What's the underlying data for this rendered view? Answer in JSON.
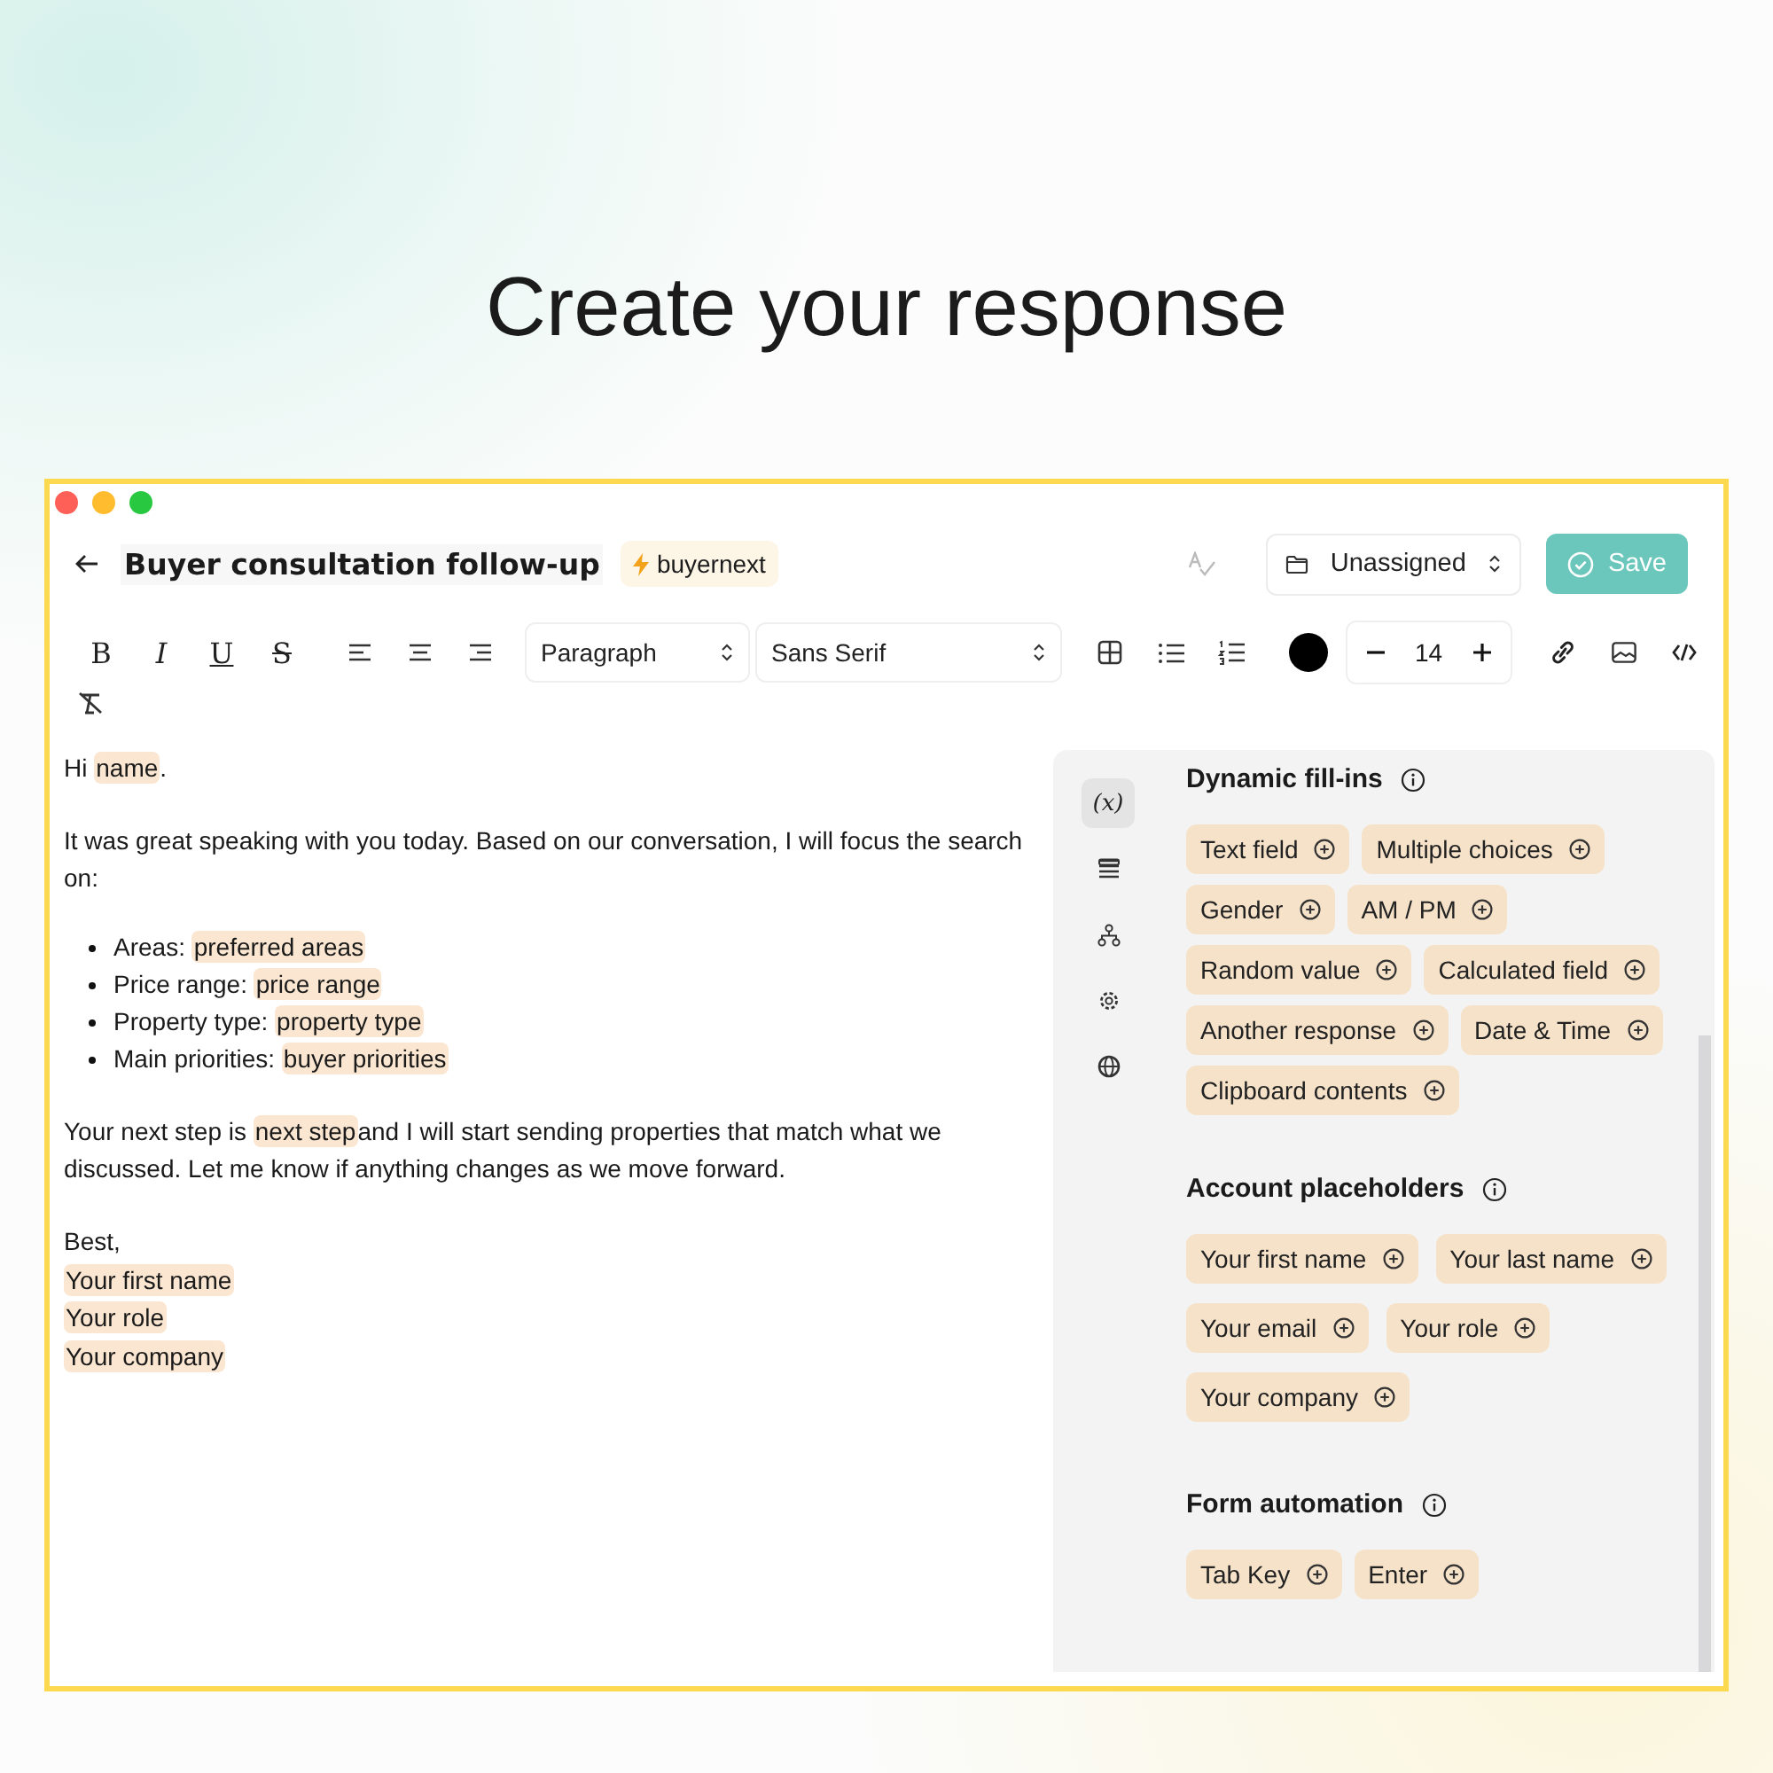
{
  "heading": "Create your response",
  "header": {
    "title": "Buyer consultation follow-up",
    "tag": "buyernext",
    "folder": "Unassigned",
    "save": "Save"
  },
  "toolbar": {
    "format": [
      {
        "kind": "bold",
        "label": "B"
      },
      {
        "kind": "italic",
        "label": "I"
      },
      {
        "kind": "underline",
        "label": "U"
      },
      {
        "kind": "strike",
        "label": "S"
      }
    ],
    "align": [
      {
        "kind": "left"
      },
      {
        "kind": "center"
      },
      {
        "kind": "right"
      }
    ],
    "block_style": "Paragraph",
    "font": "Sans Serif",
    "insert": [
      {
        "kind": "table"
      },
      {
        "kind": "bullets"
      },
      {
        "kind": "numbers"
      }
    ],
    "size": "14",
    "media": [
      {
        "kind": "link"
      },
      {
        "kind": "image"
      },
      {
        "kind": "code"
      }
    ],
    "extra": [
      {
        "kind": "clear"
      }
    ]
  },
  "body": [
    {
      "kind": "p",
      "parts": [
        {
          "text": "Hi "
        },
        {
          "fill": "name"
        },
        {
          "text": "."
        }
      ]
    },
    {
      "kind": "p",
      "parts": [
        {
          "text": "It was great speaking with you today. Based on our conversation, I will focus the search on:"
        }
      ]
    },
    {
      "kind": "list",
      "items": [
        {
          "parts": [
            {
              "text": "Areas: "
            },
            {
              "fill": "preferred areas"
            }
          ]
        },
        {
          "parts": [
            {
              "text": "Price range: "
            },
            {
              "fill": "price range"
            }
          ]
        },
        {
          "parts": [
            {
              "text": "Property type: "
            },
            {
              "fill": "property type"
            }
          ]
        },
        {
          "parts": [
            {
              "text": "Main priorities: "
            },
            {
              "fill": "buyer priorities"
            }
          ]
        }
      ]
    },
    {
      "kind": "p",
      "parts": [
        {
          "text": "Your next step is "
        },
        {
          "fill": "next step"
        },
        {
          "text": "and I will start sending properties that match what we discussed. Let me know if anything changes as we move forward."
        }
      ]
    },
    {
      "kind": "lines",
      "lines": [
        {
          "parts": [
            {
              "text": "Best,"
            }
          ]
        },
        {
          "parts": [
            {
              "fill": "Your first name"
            }
          ]
        },
        {
          "parts": [
            {
              "fill": "Your role"
            }
          ]
        },
        {
          "parts": [
            {
              "fill": "Your company"
            }
          ]
        }
      ]
    }
  ],
  "panel": {
    "rail": [
      {
        "kind": "variables",
        "label": "(x)",
        "selected": true
      },
      {
        "kind": "list",
        "selected": false
      },
      {
        "kind": "hierarchy",
        "selected": false
      },
      {
        "kind": "settings",
        "selected": false
      },
      {
        "kind": "globe",
        "selected": false
      }
    ],
    "sections": [
      {
        "title": "Dynamic fill-ins",
        "chips": [
          "Text field",
          "Multiple choices",
          "Gender",
          "AM / PM",
          "Random value",
          "Calculated field",
          "Another response",
          "Date & Time",
          "Clipboard contents"
        ]
      },
      {
        "title": "Account placeholders",
        "chips": [
          "Your first name",
          "Your last name",
          "Your email",
          "Your role",
          "Your company"
        ]
      },
      {
        "title": "Form automation",
        "chips": [
          "Tab Key",
          "Enter"
        ]
      }
    ]
  }
}
